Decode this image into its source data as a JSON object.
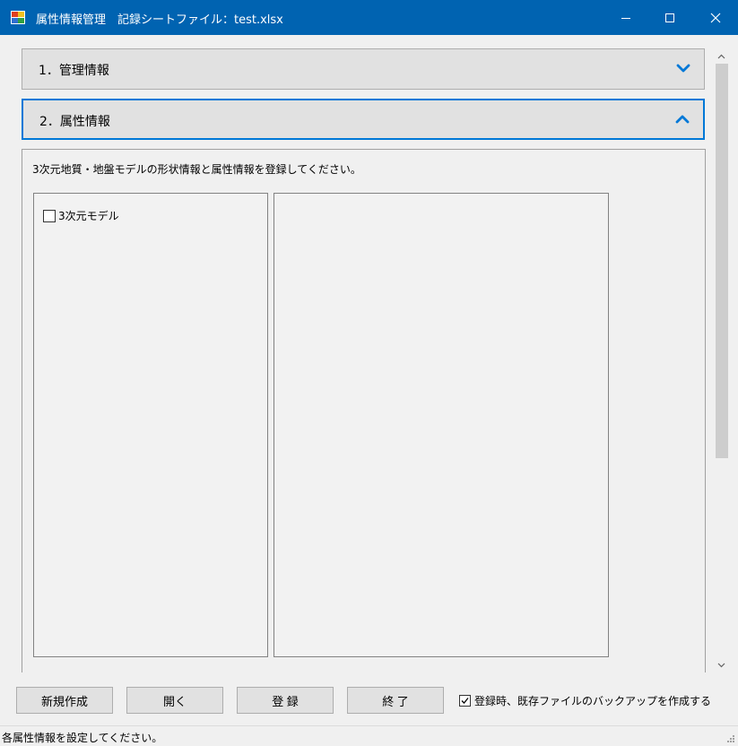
{
  "window": {
    "title": "属性情報管理　記録シートファイル：test.xlsx",
    "accent_color": "#0063b1",
    "icons": [
      "app-icon",
      "minimize-icon",
      "maximize-icon",
      "close-icon"
    ]
  },
  "sections": [
    {
      "label": "1．管理情報",
      "state": "collapsed",
      "icon": "chevron-down-icon"
    },
    {
      "label": "2．属性情報",
      "state": "expanded",
      "icon": "chevron-up-icon"
    }
  ],
  "attributes_panel": {
    "instruction": "3次元地質・地盤モデルの形状情報と属性情報を登録してください。",
    "tree": [
      {
        "label": "3次元モデル",
        "checked": false
      }
    ]
  },
  "buttons": {
    "new": "新規作成",
    "open": "開く",
    "register": "登 録",
    "exit": "終 了"
  },
  "backup_option": {
    "label": "登録時、既存ファイルのバックアップを作成する",
    "checked": true
  },
  "status": {
    "message": "各属性情報を設定してください。"
  }
}
